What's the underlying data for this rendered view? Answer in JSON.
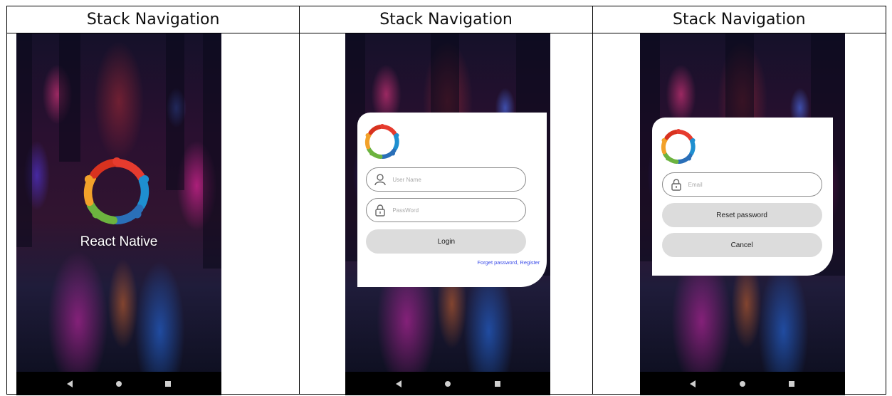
{
  "columns": [
    {
      "header": "Stack Navigation",
      "screen": "splash",
      "app_title": "React Native"
    },
    {
      "header": "Stack Navigation",
      "screen": "login",
      "username_placeholder": "User Name",
      "password_placeholder": "PassWord",
      "login_button": "Login",
      "forgot_link": "Forget password, Register"
    },
    {
      "header": "Stack Navigation",
      "screen": "reset",
      "email_placeholder": "Email",
      "reset_button": "Reset password",
      "cancel_button": "Cancel"
    }
  ],
  "icons": {
    "logo": "react-native-people-ring-logo",
    "user": "user-icon",
    "lock": "lock-icon",
    "nav_back": "back-triangle-icon",
    "nav_home": "home-circle-icon",
    "nav_recent": "recents-square-icon"
  },
  "colors": {
    "link": "#3a4be8",
    "button_bg": "#dcdcdc",
    "card_bg": "#ffffff",
    "navbar_bg": "#000000"
  }
}
